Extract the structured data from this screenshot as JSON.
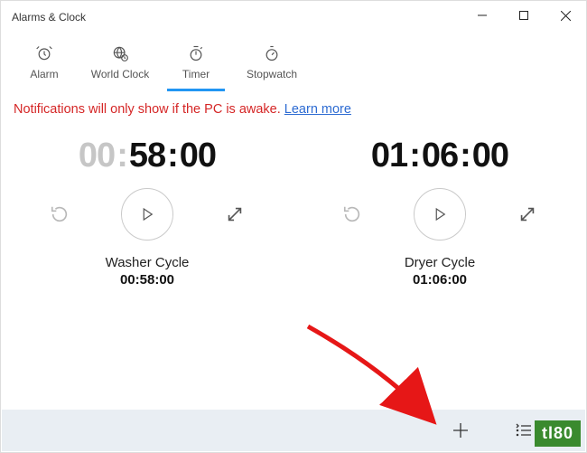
{
  "window": {
    "title": "Alarms & Clock"
  },
  "tabs": {
    "alarm": "Alarm",
    "worldclock": "World Clock",
    "timer": "Timer",
    "stopwatch": "Stopwatch",
    "active": "timer"
  },
  "notification": {
    "text": "Notifications will only show if the PC is awake. ",
    "link": "Learn more"
  },
  "timers": [
    {
      "display_hh": "00",
      "display_mm": "58",
      "display_ss": "00",
      "name": "Washer Cycle",
      "duration": "00:58:00"
    },
    {
      "display_hh": "01",
      "display_mm": "06",
      "display_ss": "00",
      "name": "Dryer Cycle",
      "duration": "01:06:00"
    }
  ],
  "watermark": "tl80"
}
